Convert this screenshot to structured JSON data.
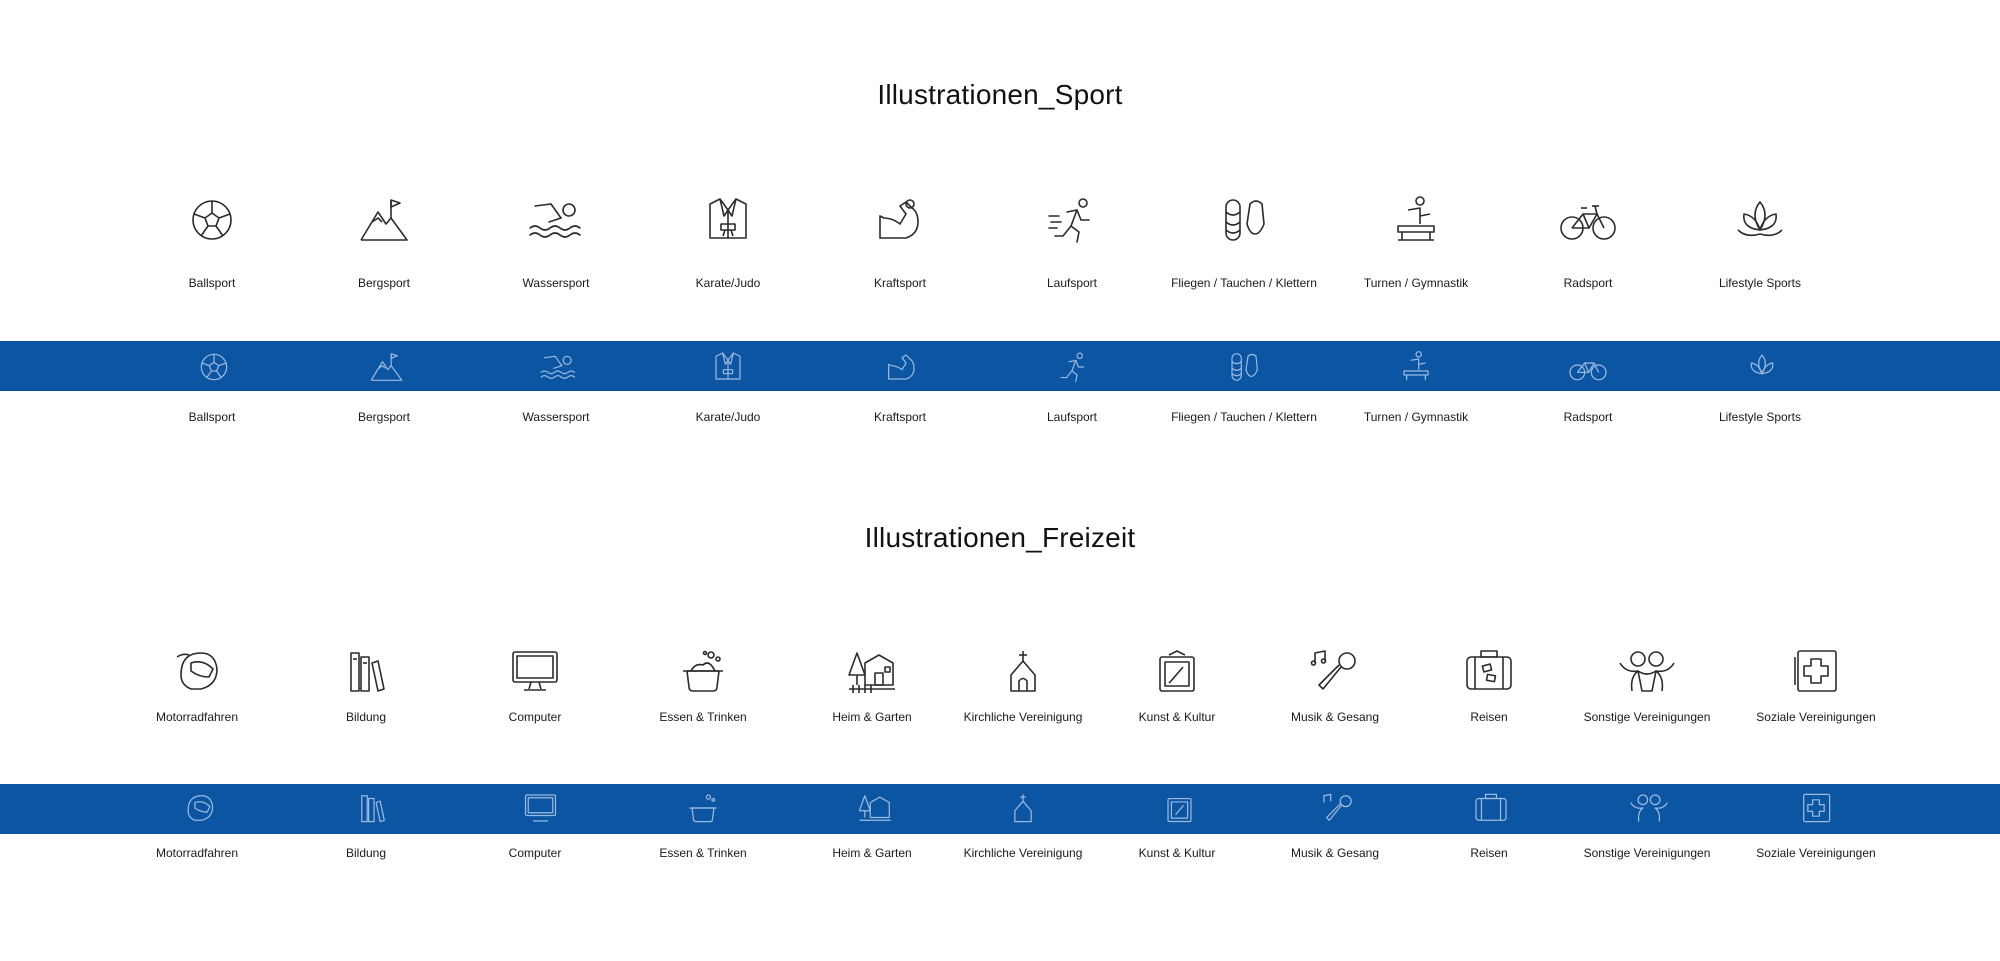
{
  "sections": [
    {
      "title": "Illustrationen_Sport",
      "icons": [
        {
          "label": "Ballsport",
          "icon": "soccer-ball-icon"
        },
        {
          "label": "Bergsport",
          "icon": "mountain-flag-icon"
        },
        {
          "label": "Wassersport",
          "icon": "swimmer-icon"
        },
        {
          "label": "Karate/Judo",
          "icon": "judo-gi-icon"
        },
        {
          "label": "Kraftsport",
          "icon": "flexed-arm-icon"
        },
        {
          "label": "Laufsport",
          "icon": "runner-icon"
        },
        {
          "label": "Fliegen / Tauchen / Klettern",
          "icon": "rope-carabiner-icon"
        },
        {
          "label": "Turnen / Gymnastik",
          "icon": "gymnast-beam-icon"
        },
        {
          "label": "Radsport",
          "icon": "bicycle-icon"
        },
        {
          "label": "Lifestyle Sports",
          "icon": "lotus-icon"
        }
      ]
    },
    {
      "title": "Illustrationen_Freizeit",
      "icons": [
        {
          "label": "Motorradfahren",
          "icon": "helmet-icon"
        },
        {
          "label": "Bildung",
          "icon": "books-icon"
        },
        {
          "label": "Computer",
          "icon": "monitor-icon"
        },
        {
          "label": "Essen & Trinken",
          "icon": "cooking-pot-icon"
        },
        {
          "label": "Heim & Garten",
          "icon": "house-garden-icon"
        },
        {
          "label": "Kirchliche Vereinigung",
          "icon": "chapel-icon"
        },
        {
          "label": "Kunst & Kultur",
          "icon": "picture-frame-icon"
        },
        {
          "label": "Musik & Gesang",
          "icon": "microphone-note-icon"
        },
        {
          "label": "Reisen",
          "icon": "suitcase-icon"
        },
        {
          "label": "Sonstige Vereinigungen",
          "icon": "people-group-icon"
        },
        {
          "label": "Soziale Vereinigungen",
          "icon": "medical-cross-icon"
        }
      ]
    }
  ],
  "colors": {
    "band": "#0c55a3",
    "icon_dark": "#2b2b2b",
    "icon_light": "#9dbbe0",
    "text": "#1a1a1a",
    "background": "#ffffff"
  }
}
